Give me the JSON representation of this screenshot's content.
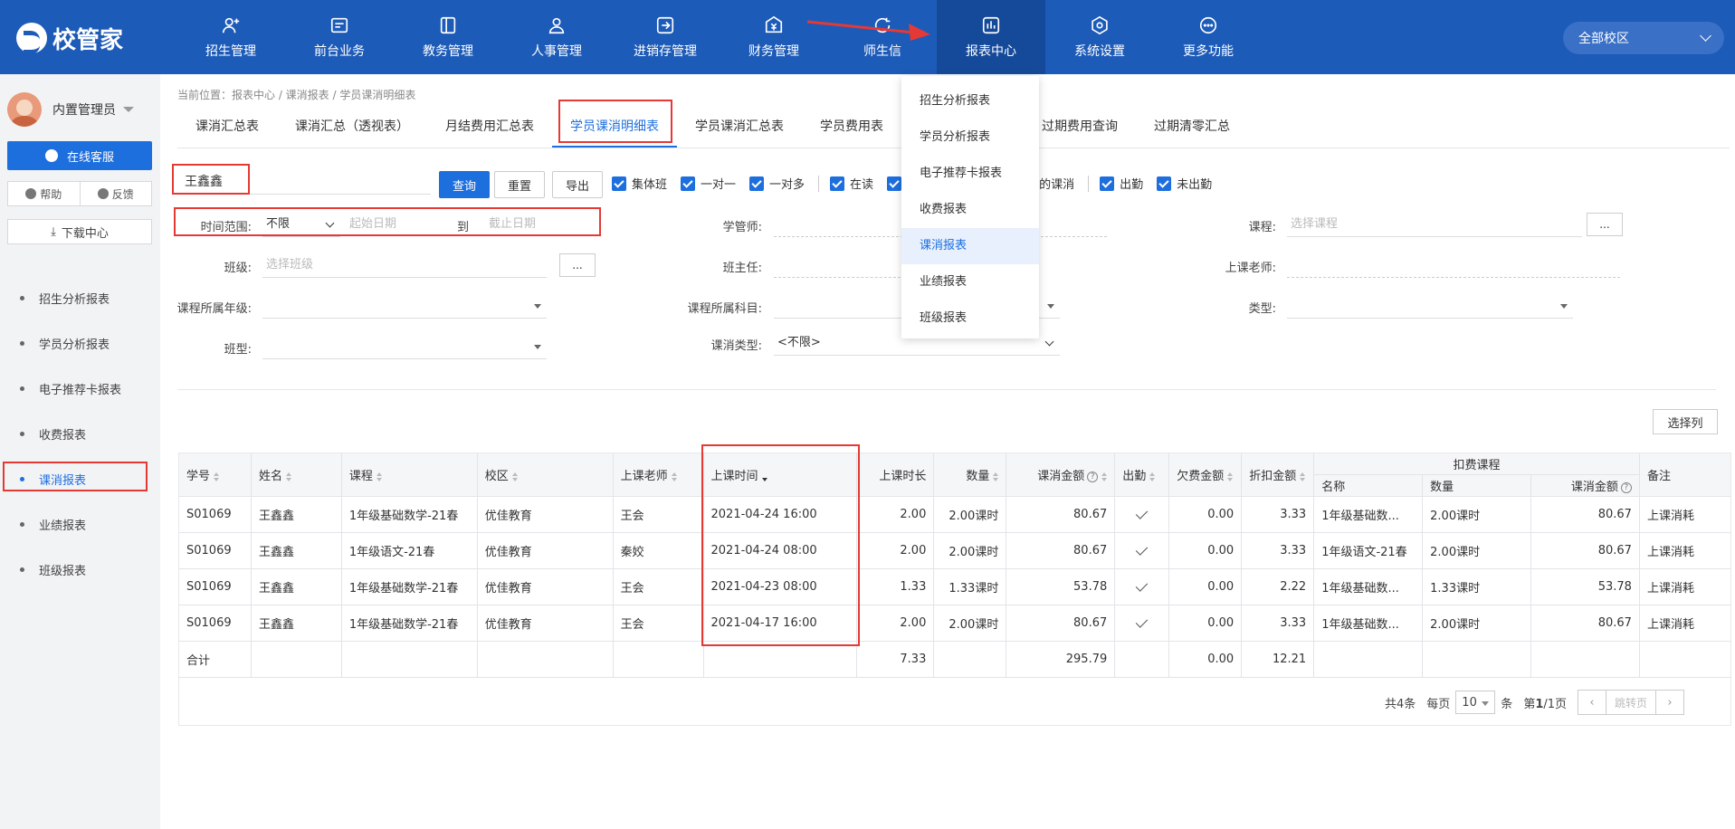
{
  "logo": "校管家",
  "nav": [
    {
      "label": "招生管理",
      "icon": "person-add-icon"
    },
    {
      "label": "前台业务",
      "icon": "desk-icon"
    },
    {
      "label": "教务管理",
      "icon": "book-icon"
    },
    {
      "label": "人事管理",
      "icon": "person-icon"
    },
    {
      "label": "进销存管理",
      "icon": "inventory-icon"
    },
    {
      "label": "财务管理",
      "icon": "finance-icon"
    },
    {
      "label": "师生信",
      "icon": "message-icon"
    },
    {
      "label": "报表中心",
      "icon": "report-icon"
    },
    {
      "label": "系统设置",
      "icon": "settings-icon"
    },
    {
      "label": "更多功能",
      "icon": "more-icon"
    }
  ],
  "campus": "全部校区",
  "sidebar": {
    "user": "内置管理员",
    "service": "在线客服",
    "help": "帮助",
    "feedback": "反馈",
    "download": "下载中心",
    "menu": [
      "招生分析报表",
      "学员分析报表",
      "电子推荐卡报表",
      "收费报表",
      "课消报表",
      "业绩报表",
      "班级报表"
    ]
  },
  "breadcrumb": "当前位置：报表中心 / 课消报表 / 学员课消明细表",
  "tabs": [
    "课消汇总表",
    "课消汇总（透视表）",
    "月结费用汇总表",
    "学员课消明细表",
    "学员课消汇总表",
    "学员费用表",
    "过期费用查询",
    "过期清零汇总"
  ],
  "search": {
    "value": "王鑫鑫",
    "query": "查询",
    "reset": "重置",
    "export": "导出"
  },
  "checks": [
    "集体班",
    "一对一",
    "一对多",
    "在读",
    "的课消",
    "出勤",
    "未出勤"
  ],
  "filters": {
    "time_label": "时间范围:",
    "time_value": "不限",
    "start_ph": "起始日期",
    "to": "到",
    "end_ph": "截止日期",
    "manager_label": "学管师:",
    "course_label": "课程:",
    "course_ph": "选择课程",
    "class_label": "班级:",
    "class_ph": "选择班级",
    "head_label": "班主任:",
    "teacher_label": "上课老师:",
    "grade_label": "课程所属年级:",
    "subject_label": "课程所属科目:",
    "type_label": "类型:",
    "classtype_label": "班型:",
    "consume_label": "课消类型:",
    "consume_value": "<不限>",
    "dots": "..."
  },
  "select_columns": "选择列",
  "table": {
    "headers": [
      "学号",
      "姓名",
      "课程",
      "校区",
      "上课老师",
      "上课时间",
      "上课时长",
      "数量",
      "课消金额",
      "出勤",
      "欠费金额",
      "折扣金额",
      "名称",
      "数量",
      "课消金额",
      "备注"
    ],
    "group_header": "扣费课程",
    "rows": [
      [
        "S01069",
        "王鑫鑫",
        "1年级基础数学-21春",
        "优佳教育",
        "王会",
        "2021-04-24 16:00",
        "2.00",
        "2.00课时",
        "80.67",
        "0.00",
        "3.33",
        "1年级基础数...",
        "2.00课时",
        "80.67",
        "上课消耗"
      ],
      [
        "S01069",
        "王鑫鑫",
        "1年级语文-21春",
        "优佳教育",
        "秦姣",
        "2021-04-24 08:00",
        "2.00",
        "2.00课时",
        "80.67",
        "0.00",
        "3.33",
        "1年级语文-21春",
        "2.00课时",
        "80.67",
        "上课消耗"
      ],
      [
        "S01069",
        "王鑫鑫",
        "1年级基础数学-21春",
        "优佳教育",
        "王会",
        "2021-04-23 08:00",
        "1.33",
        "1.33课时",
        "53.78",
        "0.00",
        "2.22",
        "1年级基础数...",
        "1.33课时",
        "53.78",
        "上课消耗"
      ],
      [
        "S01069",
        "王鑫鑫",
        "1年级基础数学-21春",
        "优佳教育",
        "王会",
        "2021-04-17 16:00",
        "2.00",
        "2.00课时",
        "80.67",
        "0.00",
        "3.33",
        "1年级基础数...",
        "2.00课时",
        "80.67",
        "上课消耗"
      ]
    ],
    "total": {
      "label": "合计",
      "hours": "7.33",
      "amount": "295.79",
      "owed": "0.00",
      "discount": "12.21"
    }
  },
  "pager": {
    "total": "共4条",
    "per_page": "每页",
    "size": "10",
    "unit": "条",
    "page_prefix": "第",
    "page_current": "1",
    "page_rest": "/1页",
    "jump": "跳转页"
  },
  "dropdown": [
    "招生分析报表",
    "学员分析报表",
    "电子推荐卡报表",
    "收费报表",
    "课消报表",
    "业绩报表",
    "班级报表"
  ],
  "colors": {
    "primary": "#1e6fde",
    "topbar": "#1d5bb8",
    "highlight": "#e53935"
  }
}
